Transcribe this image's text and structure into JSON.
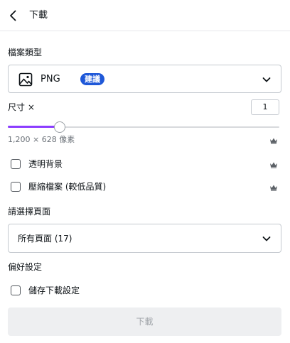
{
  "header": {
    "title": "下載",
    "back_icon": "chevron-left-icon"
  },
  "file_type": {
    "label": "檔案類型",
    "value": "PNG",
    "badge": "建議",
    "icon": "image-icon",
    "dropdown_icon": "chevron-down-icon",
    "badge_color": "#1f58d8"
  },
  "size": {
    "label": "尺寸 ×",
    "value": "1",
    "slider_fraction": 0.19,
    "slider_color": "#8b3dff",
    "dimensions": "1,200 × 628 像素",
    "premium_icon": "crown-icon"
  },
  "options": {
    "transparent_bg": {
      "label": "透明背景",
      "checked": false,
      "premium_icon": "crown-icon"
    },
    "compress": {
      "label": "壓縮檔案 (較低品質)",
      "checked": false,
      "premium_icon": "crown-icon"
    }
  },
  "pages": {
    "label": "請選擇頁面",
    "value": "所有頁面 (17)",
    "dropdown_icon": "chevron-down-icon"
  },
  "preferences": {
    "label": "偏好設定",
    "save_settings": {
      "label": "儲存下載設定",
      "checked": false
    }
  },
  "download_button": {
    "label": "下載",
    "enabled": false
  }
}
